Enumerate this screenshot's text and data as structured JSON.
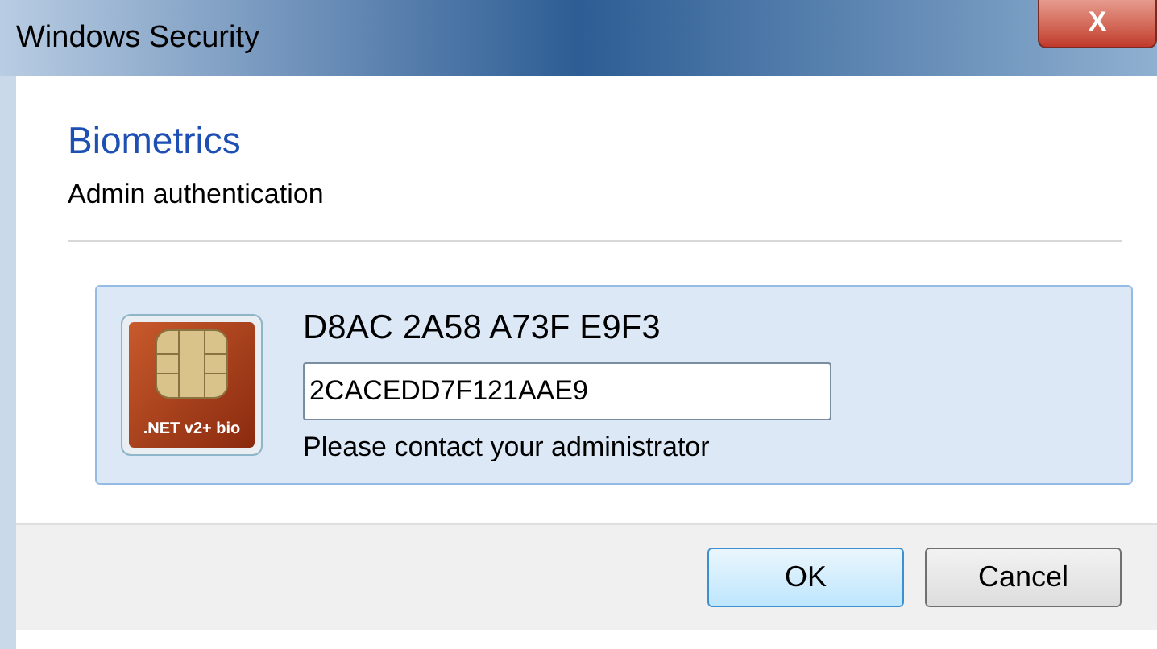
{
  "window": {
    "title": "Windows Security",
    "close": "X"
  },
  "heading": "Biometrics",
  "subheading": "Admin authentication",
  "credential": {
    "icon_label": ".NET v2+ bio",
    "name": "D8AC 2A58 A73F E9F3",
    "field_value": "2CACEDD7F121AAE9",
    "message": "Please contact your administrator",
    "selected": true
  },
  "buttons": [
    {
      "label": "OK",
      "default": true
    },
    {
      "label": "Cancel",
      "default": false
    }
  ]
}
